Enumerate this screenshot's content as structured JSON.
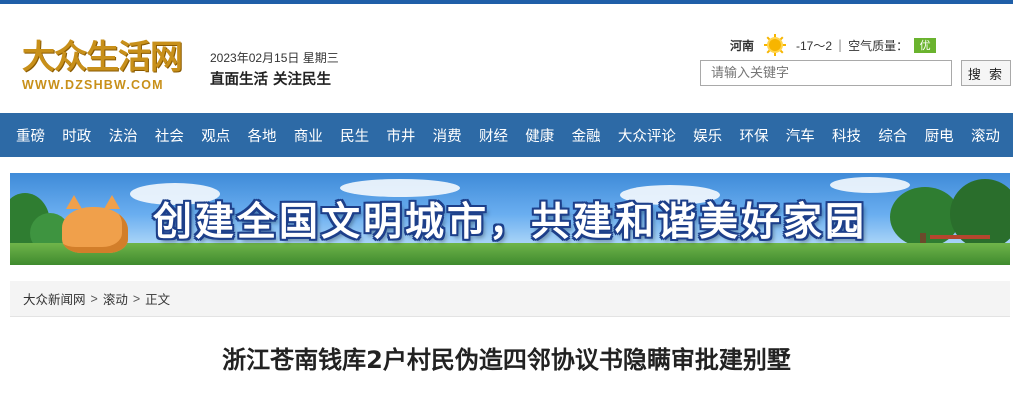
{
  "header": {
    "logo_cn": "大众生活网",
    "logo_en": "WWW.DZSHBW.COM",
    "date": "2023年02月15日 星期三",
    "slogan": "直面生活 关注民生"
  },
  "weather": {
    "city": "河南",
    "icon": "sun-icon",
    "temperature": "-17～2",
    "separator": "|",
    "air_quality_label": "空气质量：",
    "air_quality_value": "优",
    "air_quality_color": "#6ab32e"
  },
  "search": {
    "placeholder": "请输入关键字",
    "button_label": "搜 索"
  },
  "nav": {
    "background": "#2d6aa6",
    "items": [
      "重磅",
      "时政",
      "法治",
      "社会",
      "观点",
      "各地",
      "商业",
      "民生",
      "市井",
      "消费",
      "财经",
      "健康",
      "金融",
      "大众评论",
      "娱乐",
      "环保",
      "汽车",
      "科技",
      "综合",
      "厨电",
      "滚动"
    ]
  },
  "banner": {
    "text": "创建全国文明城市，共建和谐美好家园"
  },
  "breadcrumb": {
    "items": [
      "大众新闻网",
      "滚动",
      "正文"
    ],
    "separator": ">"
  },
  "article": {
    "title": "浙江苍南钱库2户村民伪造四邻协议书隐瞒审批建别墅"
  }
}
